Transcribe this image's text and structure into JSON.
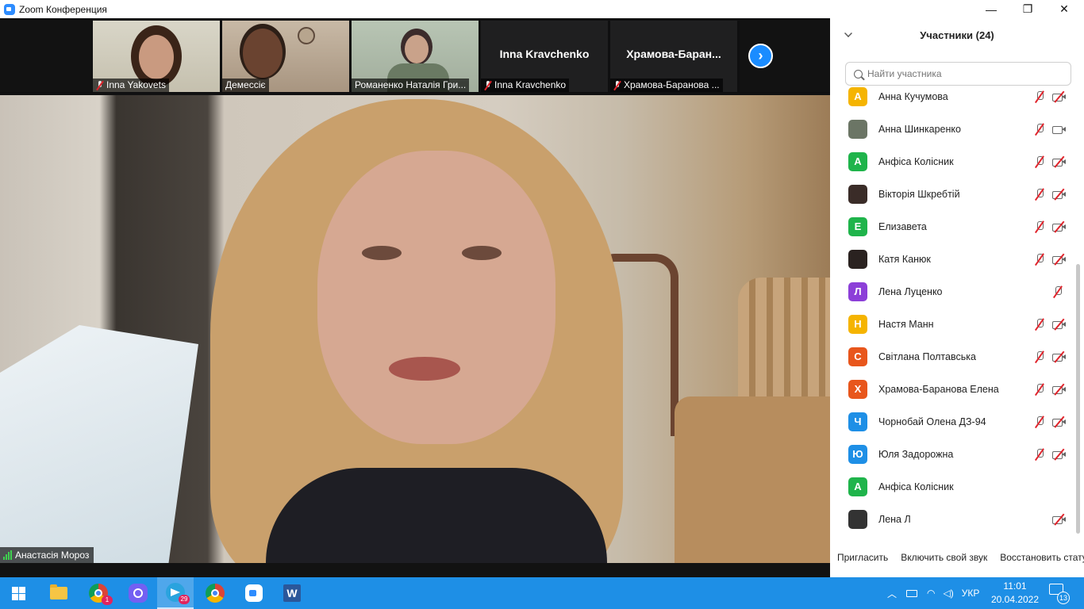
{
  "window": {
    "title": "Zoom Конференция",
    "controls": {
      "minimize": "—",
      "maximize": "❐",
      "close": "✕"
    }
  },
  "gallery": {
    "tiles": [
      {
        "name": "Inna Yakovets",
        "muted": true,
        "video": true
      },
      {
        "name": "Демессіє",
        "muted": false,
        "video": true
      },
      {
        "name": "Романенко Наталія Гри...",
        "muted": false,
        "video": true
      },
      {
        "name": "Inna Kravchenko",
        "display_name": "Inna Kravchenko",
        "muted": true,
        "video": false
      },
      {
        "name": "Храмова-Баранова ...",
        "display_name": "Храмова-Баран...",
        "muted": true,
        "video": false
      }
    ],
    "next_button": "›"
  },
  "main_video": {
    "speaker_name": "Анастасія Мороз"
  },
  "participants_panel": {
    "title": "Участники (24)",
    "search_placeholder": "Найти участника",
    "items": [
      {
        "initial": "А",
        "color": "#f5b400",
        "name": "Анна Кучумова",
        "mic": "muted",
        "cam": "off"
      },
      {
        "initial": "",
        "color": "#6b7565",
        "name": "Анна Шинкаренко",
        "mic": "muted",
        "cam": "on"
      },
      {
        "initial": "А",
        "color": "#1fb44b",
        "name": "Анфіса Колісник",
        "mic": "muted",
        "cam": "off"
      },
      {
        "initial": "",
        "color": "#3a2c28",
        "name": "Вікторія Шкребтій",
        "mic": "muted",
        "cam": "off"
      },
      {
        "initial": "Е",
        "color": "#1fb44b",
        "name": "Елизавета",
        "mic": "muted",
        "cam": "off"
      },
      {
        "initial": "",
        "color": "#2a2220",
        "name": "Катя Канюк",
        "mic": "muted",
        "cam": "off"
      },
      {
        "initial": "Л",
        "color": "#8c3fd8",
        "name": "Лена Луценко",
        "mic": "muted",
        "cam": "none"
      },
      {
        "initial": "Н",
        "color": "#f5b400",
        "name": "Настя Манн",
        "mic": "muted",
        "cam": "off"
      },
      {
        "initial": "С",
        "color": "#e8561c",
        "name": "Світлана Полтавська",
        "mic": "muted",
        "cam": "off"
      },
      {
        "initial": "Х",
        "color": "#e8561c",
        "name": "Храмова-Баранова Елена",
        "mic": "muted",
        "cam": "off"
      },
      {
        "initial": "Ч",
        "color": "#1e8fe6",
        "name": "Чорнобай Олена ДЗ-94",
        "mic": "muted",
        "cam": "off"
      },
      {
        "initial": "Ю",
        "color": "#1e8fe6",
        "name": "Юля Задорожна",
        "mic": "muted",
        "cam": "off"
      },
      {
        "initial": "А",
        "color": "#1fb44b",
        "name": "Анфіса Колісник",
        "mic": "none",
        "cam": "none"
      },
      {
        "initial": "",
        "color": "#333333",
        "name": "Лена Л",
        "mic": "none",
        "cam": "off"
      }
    ],
    "footer": {
      "invite": "Пригласить",
      "unmute_self": "Включить свой звук",
      "reclaim_host": "Восстановить стату"
    }
  },
  "taskbar": {
    "apps": [
      {
        "icon": "windows-start-icon"
      },
      {
        "icon": "file-explorer-icon"
      },
      {
        "icon": "chrome-icon",
        "badge": "1"
      },
      {
        "icon": "viber-icon",
        "badge": ""
      },
      {
        "icon": "telegram-icon",
        "badge": "29"
      },
      {
        "icon": "chrome-icon",
        "badge": ""
      },
      {
        "icon": "zoom-icon"
      },
      {
        "icon": "word-icon",
        "letter": "W"
      }
    ],
    "tray": {
      "language": "УКР",
      "time": "11:01",
      "date": "20.04.2022",
      "notifications": "13"
    }
  }
}
